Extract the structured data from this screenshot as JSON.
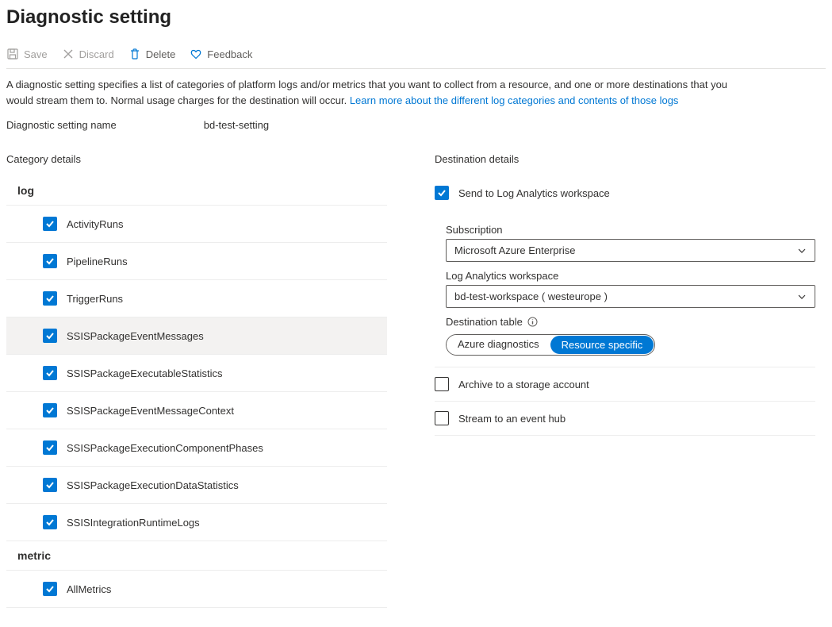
{
  "page_title": "Diagnostic setting",
  "toolbar": {
    "save": "Save",
    "discard": "Discard",
    "delete": "Delete",
    "feedback": "Feedback"
  },
  "description_text": "A diagnostic setting specifies a list of categories of platform logs and/or metrics that you want to collect from a resource, and one or more destinations that you would stream them to. Normal usage charges for the destination will occur. ",
  "description_link": "Learn more about the different log categories and contents of those logs",
  "setting_name_label": "Diagnostic setting name",
  "setting_name_value": "bd-test-setting",
  "category_details_heading": "Category details",
  "log_heading": "log",
  "log_categories": [
    "ActivityRuns",
    "PipelineRuns",
    "TriggerRuns",
    "SSISPackageEventMessages",
    "SSISPackageExecutableStatistics",
    "SSISPackageEventMessageContext",
    "SSISPackageExecutionComponentPhases",
    "SSISPackageExecutionDataStatistics",
    "SSISIntegrationRuntimeLogs"
  ],
  "metric_heading": "metric",
  "metric_categories": [
    "AllMetrics"
  ],
  "destination_details_heading": "Destination details",
  "destinations": {
    "log_analytics": "Send to Log Analytics workspace",
    "storage": "Archive to a storage account",
    "event_hub": "Stream to an event hub"
  },
  "la_details": {
    "subscription_label": "Subscription",
    "subscription_value": "Microsoft Azure Enterprise",
    "workspace_label": "Log Analytics workspace",
    "workspace_value": "bd-test-workspace ( westeurope )",
    "dest_table_label": "Destination table",
    "pill_option1": "Azure diagnostics",
    "pill_option2": "Resource specific"
  }
}
